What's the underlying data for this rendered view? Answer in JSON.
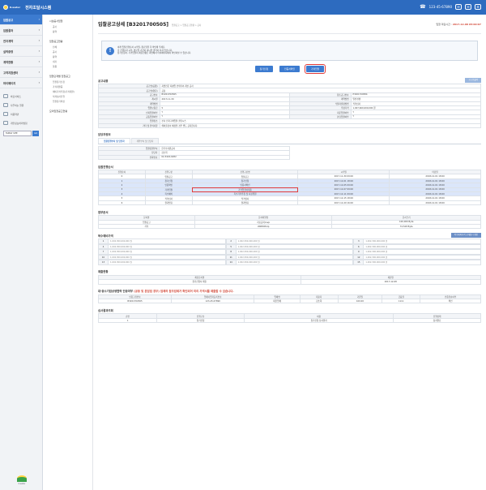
{
  "header": {
    "brand": "K-water",
    "title": "전자조달시스템",
    "phone": "123-45-67890",
    "icons": [
      "phone-icon",
      "mail-icon",
      "mail-icon",
      "settings-icon"
    ]
  },
  "sidebar": {
    "items": [
      {
        "label": "입찰공고",
        "active": true
      },
      {
        "label": "입찰결과",
        "active": false
      },
      {
        "label": "전자계약",
        "active": false
      },
      {
        "label": "실적증명",
        "active": false
      },
      {
        "label": "계약현황",
        "active": false
      },
      {
        "label": "고객지원센터",
        "active": false
      },
      {
        "label": "마이페이지",
        "active": false
      }
    ],
    "small": [
      "바로서비스",
      "자주하는 질문",
      "이용약관",
      "개인정보처리방침"
    ],
    "select_value": "FAMILY SITE",
    "go_label": "GO"
  },
  "submenu": {
    "groups": [
      {
        "label": "시설공사입찰",
        "subs": [
          "공사",
          "용역"
        ]
      },
      {
        "label": "입찰공고현황",
        "subs": [
          "전체",
          "공사",
          "용역",
          "내자",
          "물품"
        ]
      },
      {
        "label": "입찰단계별 입찰공고",
        "subs": [
          "입찰참가신청",
          "가격개찰중",
          "예비가격추첨(가격개찰)",
          "적격심사진행",
          "입찰참가확정"
        ]
      },
      {
        "label": "모의입찰공고현황",
        "subs": []
      }
    ]
  },
  "page": {
    "title": "입찰공고상세 [B3201700505]",
    "breadcrumb": "입찰공고 > 입찰공고현황 > 공사",
    "deadline_label": "입찰 마감시간 : ",
    "deadline_value": "2017-12-08 05:00:07"
  },
  "notice": {
    "lines": [
      "아래 입찰진행순서 시작일, 종료일을 꼭 확인해 주세요.",
      "각 진행순서 시작, 종료일 기간이 아니면 클릭이 되지 않습니다.",
      "참가신청서, 가격입찰서 제출현황은 화면에서 마이페이지에서 확인하실 수 있습니다."
    ]
  },
  "buttons": {
    "apply": "참가신청",
    "view_cert": "인증서확인",
    "bid": "가격입찰"
  },
  "sections": {
    "notice_detail": "공고내용",
    "print": "공고문출력",
    "contact": "담당자정보",
    "schedule": "입찰진행순서",
    "files": "첨부문서",
    "prices": "복수예비가격",
    "price_btn": "복수예비가격 공개일시 확인",
    "status": "제출현황",
    "sme": "대·중소기업상생협력 인증여부",
    "sme_warn": "(공동 및 분담업 경우) 업체의 참조업체가 확인되어 미리 가격서를 제출할 수 있습니다.",
    "result": "심사결과조회"
  },
  "detail": [
    [
      "공고명(공종)",
      "지방전문 지평업 인테리어 개선 공사",
      "",
      ""
    ],
    [
      "공고명(영문)",
      "공통",
      "",
      ""
    ],
    [
      "공고번호",
      "B3201700505",
      "참조공고번호",
      "P3201700584"
    ],
    [
      "계시일",
      "2017-11-30",
      "계약방법",
      "일반경쟁"
    ],
    [
      "계약방법",
      "",
      "낙찰자결정방법",
      "적격심사"
    ],
    [
      "입찰보증금",
      "5",
      "추정가격",
      "1,007,600,000,000 원"
    ],
    [
      "인지입찰여부",
      "Y",
      "지문입찰여부",
      "Y"
    ],
    [
      "공동입찰여부",
      "Y",
      "분담입찰여부",
      "Y"
    ],
    [
      "입찰장소",
      "본사 전자구매입찰 클린시스",
      "",
      ""
    ],
    [
      "기타 및 유의사항",
      "해외출장이 예정될 경우 별도 공지합니다.",
      "",
      ""
    ]
  ],
  "contact": {
    "tabs": [
      "입찰진행부서 및 담당자",
      "계약부서 및 담당자"
    ],
    "rows": [
      [
        "입찰집행부서",
        "한국수자원공사"
      ],
      [
        "담당자",
        "김소희"
      ],
      [
        "전화번호",
        "02-3424-6282"
      ]
    ]
  },
  "schedule": {
    "headers": [
      "진행순서",
      "진행구분",
      "진행구분명",
      "시작일",
      "마감일"
    ],
    "rows": [
      [
        "0",
        "입찰공고",
        "입찰공고",
        "2017-11-30 09:00",
        "2018-12-01 18:00"
      ],
      [
        "1",
        "참가신청",
        "참가신청",
        "2017-12-01 18:00",
        "2018-12-01 18:00"
      ],
      [
        "2",
        "인증확인",
        "인증서확인",
        "2017-12-05 09:00",
        "2018-12-01 18:00"
      ],
      [
        "3",
        "가격입찰",
        "가격입찰서제출",
        "2017-12-07 09:00",
        "2018-12-01 18:00"
      ],
      [
        "4",
        "복수예비",
        "복수가격추첨 및 사정위원",
        "2017-12-11 09:00",
        "2018-12-01 18:00"
      ],
      [
        "5",
        "적격심사",
        "적격심사",
        "2017-12-15 18:00",
        "2018-12-01 18:00"
      ],
      [
        "6",
        "결과발표",
        "결과발표",
        "2017-12-29 16:00",
        "2018-12-01 18:00"
      ]
    ]
  },
  "files": {
    "headers": [
      "문서명",
      "문서파일명",
      "문서크기"
    ],
    "rows": [
      [
        "입찰공고",
        "자료공지.hwp",
        "100,000 Byte"
      ],
      [
        "기타",
        "UNIMOP.zip",
        "74,528 Byte"
      ]
    ]
  },
  "prices": [
    [
      "1",
      "1,002,300,000,000 원"
    ],
    [
      "2",
      "1,002,300,000,000 원"
    ],
    [
      "3",
      "1,002,300,000,000 원"
    ],
    [
      "4",
      "1,002,300,000,000 원"
    ],
    [
      "5",
      "1,002,300,000,000 원"
    ],
    [
      "6",
      "1,002,300,000,000 원"
    ],
    [
      "7",
      "1,002,300,000,000 원"
    ],
    [
      "8",
      "1,002,300,000,000 원"
    ],
    [
      "9",
      "1,002,300,000,000 원"
    ],
    [
      "10",
      "1,002,300,000,000 원"
    ],
    [
      "11",
      "1,002,300,000,000 원"
    ],
    [
      "12",
      "1,002,300,000,000 원"
    ],
    [
      "13",
      "1,002,300,000,000 원"
    ],
    [
      "14",
      "1,002,300,000,000 원"
    ],
    [
      "15",
      "1,002,300,000,000 원"
    ]
  ],
  "status": {
    "headers": [
      "제출문서명",
      "제출일"
    ],
    "rows": [
      [
        "참가신청서 제출",
        "2017-12-08"
      ]
    ]
  },
  "sme": {
    "headers": [
      "인증고유번호",
      "업체사업자등록번호",
      "업체명",
      "대표자",
      "기준일",
      "금융권",
      "인증유효여부"
    ],
    "rows": [
      [
        "B3201700505",
        "123-45-67890",
        "대한업체",
        "김소희",
        "100.00",
        "1111",
        "확인"
      ]
    ]
  },
  "result": {
    "headers": [
      "순번",
      "진행구분",
      "내용",
      "진행상태"
    ],
    "rows": [
      [
        "1",
        "참가신청",
        "참가신청 심사결과",
        "통과완료"
      ]
    ]
  }
}
